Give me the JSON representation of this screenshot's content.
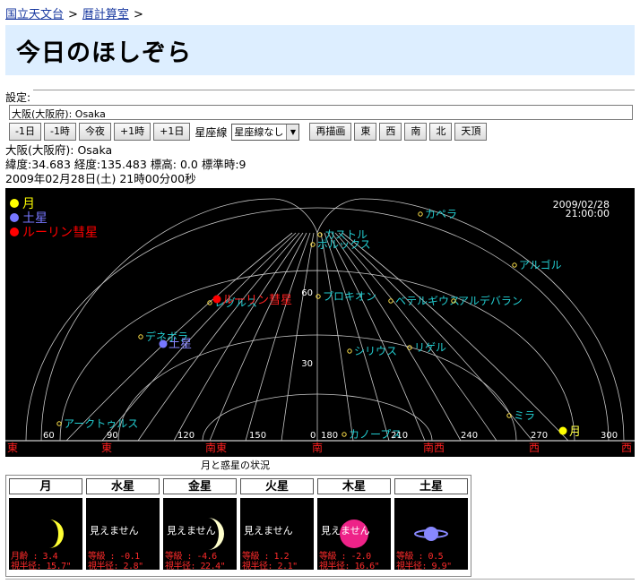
{
  "breadcrumb": {
    "home": "国立天文台",
    "sep": ">",
    "section": "暦計算室"
  },
  "page_title": "今日のほしぞら",
  "settings": {
    "legend": "設定:",
    "location_value": "大阪(大阪府): Osaka",
    "buttons": {
      "minus_day": "-1日",
      "minus_hour": "-1時",
      "tonight": "今夜",
      "plus_hour": "+1時",
      "plus_day": "+1日",
      "redraw": "再描画",
      "east": "東",
      "west": "西",
      "south": "南",
      "north": "北",
      "zenith": "天頂"
    },
    "constellation_label": "星座線",
    "constellation_select": "星座線なし"
  },
  "info": {
    "place": "大阪(大阪府): Osaka",
    "coords": "緯度:34.683 経度:135.483 標高: 0.0 標準時:9",
    "datetime": "2009年02月28日(土) 21時00分00秒"
  },
  "sky": {
    "stamp_date": "2009/02/28",
    "stamp_time": "21:00:00",
    "legend": [
      {
        "label": "月",
        "color": "#ffff00"
      },
      {
        "label": "土星",
        "color": "#7777ff"
      },
      {
        "label": "ルーリン彗星",
        "color": "#ff0000"
      }
    ],
    "stars": [
      {
        "name": "カペラ"
      },
      {
        "name": "カストル"
      },
      {
        "name": "ポルックス"
      },
      {
        "name": "アルゴル"
      },
      {
        "name": "プロキオン"
      },
      {
        "name": "ベテルギウス"
      },
      {
        "name": "アルデバラン"
      },
      {
        "name": "レグルス"
      },
      {
        "name": "デネボラ"
      },
      {
        "name": "シリウス"
      },
      {
        "name": "リゲル"
      },
      {
        "name": "ミラ"
      },
      {
        "name": "アークトゥルス"
      },
      {
        "name": "カノープス"
      }
    ],
    "bodies": {
      "moon": "月",
      "saturn": "土星",
      "comet": "ルーリン彗星"
    },
    "alt_labels": [
      "60",
      "30"
    ],
    "az_labels": [
      "60",
      "90",
      "120",
      "150",
      "0",
      "180",
      "210",
      "240",
      "270",
      "300"
    ],
    "directions": [
      "東",
      "東",
      "南東",
      "南",
      "南西",
      "西",
      "西"
    ]
  },
  "status_caption": "月と惑星の状況",
  "planets": [
    {
      "name": "月",
      "visible": true,
      "l1": "月齢  :  3.4",
      "l2": "視半径: 15.7\"",
      "color": "#ffff33"
    },
    {
      "name": "水星",
      "visible": false,
      "note": "見えません",
      "l1": "等級  : -0.1",
      "l2": "視半径:  2.8\""
    },
    {
      "name": "金星",
      "visible": false,
      "note": "見えません",
      "l1": "等級  : -4.6",
      "l2": "視半径: 22.4\"",
      "color": "#ffffcc"
    },
    {
      "name": "火星",
      "visible": false,
      "note": "見えません",
      "l1": "等級  :  1.2",
      "l2": "視半径:  2.1\""
    },
    {
      "name": "木星",
      "visible": false,
      "note": "見えません",
      "l1": "等級  : -2.0",
      "l2": "視半径: 16.6\"",
      "color": "#ee2288"
    },
    {
      "name": "土星",
      "visible": true,
      "l1": "等級  :  0.5",
      "l2": "視半径:  9.9\"",
      "color": "#8888ff"
    }
  ]
}
